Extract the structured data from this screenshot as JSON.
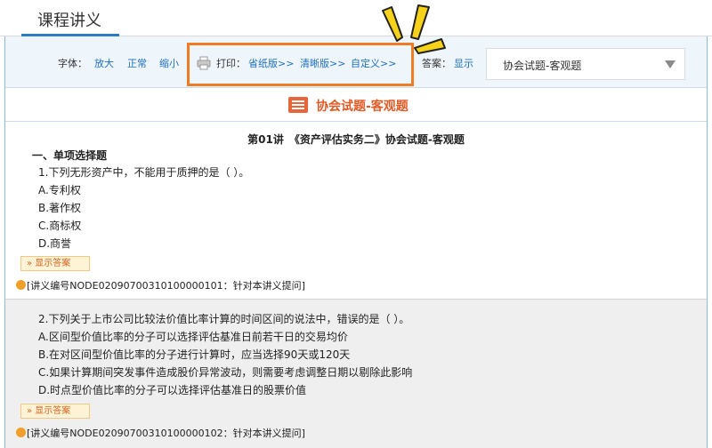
{
  "header": {
    "tab_title": "课程讲义"
  },
  "toolbar": {
    "font_label": "字体：",
    "font_large": "放大",
    "font_normal": "正常",
    "font_small": "缩小",
    "print_label": "打印：",
    "print_save_paper": "省纸版>>",
    "print_clear": "清晰版>>",
    "print_custom": "自定义>>",
    "answer_label": "答案：",
    "answer_show": "显示",
    "select_value": "协会试题-客观题"
  },
  "section": {
    "title": "协会试题-客观题"
  },
  "lecture": {
    "title": "第01讲　《资产评估实务二》协会试题-客观题",
    "section_heading": "一、单项选择题"
  },
  "questions": [
    {
      "stem": "1.下列无形资产中，不能用于质押的是（  ）。",
      "options": [
        "A.专利权",
        "B.著作权",
        "C.商标权",
        "D.商誉"
      ],
      "show_answer_label": "» 显示答案",
      "note": "[讲义编号NODE02090700310100000101：针对本讲义提问]"
    },
    {
      "stem": "2.下列关于上市公司比较法价值比率计算的时间区间的说法中，错误的是（  ）。",
      "options": [
        "A.区间型价值比率的分子可以选择评估基准日前若干日的交易均价",
        "B.在对区间型价值比率的分子进行计算时，应当选择90天或120天",
        "C.如果计算期间突发事件造成股价异常波动，则需要考虑调整日期以剔除此影响",
        "D.时点型价值比率的分子可以选择评估基准日的股票价值"
      ],
      "show_answer_label": "» 显示答案",
      "note": "[讲义编号NODE02090700310100000102：针对本讲义提问]"
    }
  ],
  "colors": {
    "accent": "#2f7bc5",
    "highlight": "#f07b22",
    "title": "#e05a26",
    "burst": "#f7d21a"
  }
}
